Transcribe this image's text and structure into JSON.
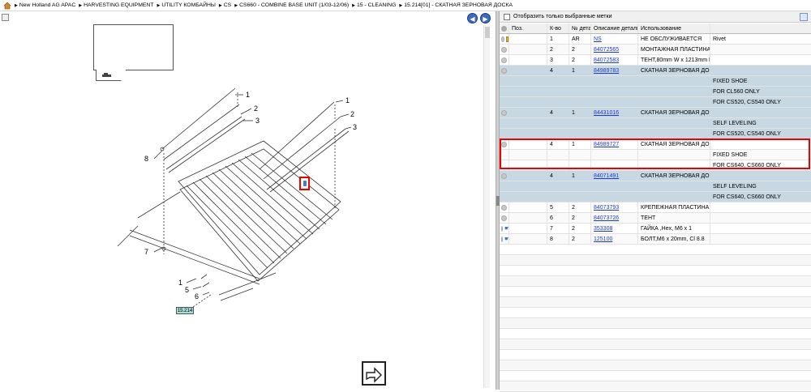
{
  "breadcrumb": [
    "New Holland AG APAC",
    "HARVESTING EQUIPMENT",
    "UTILITY КОМБАЙНЫ",
    "CS",
    "CS660 - COMBINE BASE UNIT (1/03-12/06)",
    "15 - CLEANING",
    "15.214[01] - СКАТНАЯ ЗЕРНОВАЯ ДОСКА"
  ],
  "filter_label": "Отобразить только выбранные метки",
  "columns": [
    "",
    "Поз.",
    "К-во",
    "№ детали",
    "Описание детали",
    "Использование"
  ],
  "rows": [
    {
      "kind": "part",
      "icons": [
        "circle",
        "box"
      ],
      "pos": "1",
      "qty": "AR",
      "part": "NS",
      "desc": "НЕ ОБСЛУЖИВАЕТСЯ",
      "use": "Rivet"
    },
    {
      "kind": "part",
      "icons": [
        "circle"
      ],
      "pos": "2",
      "qty": "2",
      "part": "84072565",
      "desc": "МОНТАЖНАЯ ПЛАСТИНА",
      "use": ""
    },
    {
      "kind": "part",
      "icons": [
        "circle"
      ],
      "pos": "3",
      "qty": "2",
      "part": "84072583",
      "desc": "ТЕНТ,80mm W x 1213mm L",
      "use": ""
    },
    {
      "kind": "blue",
      "icons": [
        "circle"
      ],
      "pos": "4",
      "qty": "1",
      "part": "84989783",
      "desc": "СКАТНАЯ ЗЕРНОВАЯ ДОС",
      "use": ""
    },
    {
      "kind": "blue",
      "icons": [],
      "pos": "",
      "qty": "",
      "part": "",
      "desc": "",
      "use": "FIXED SHOE"
    },
    {
      "kind": "blue",
      "icons": [],
      "pos": "",
      "qty": "",
      "part": "",
      "desc": "",
      "use": "FOR CL560 ONLY"
    },
    {
      "kind": "blue",
      "icons": [],
      "pos": "",
      "qty": "",
      "part": "",
      "desc": "",
      "use": "FOR CS520, CS540 ONLY"
    },
    {
      "kind": "blue",
      "icons": [
        "circle"
      ],
      "pos": "4",
      "qty": "1",
      "part": "84431016",
      "desc": "СКАТНАЯ ЗЕРНОВАЯ ДОС",
      "use": ""
    },
    {
      "kind": "blue",
      "icons": [],
      "pos": "",
      "qty": "",
      "part": "",
      "desc": "",
      "use": "SELF LEVELING"
    },
    {
      "kind": "blue",
      "icons": [],
      "pos": "",
      "qty": "",
      "part": "",
      "desc": "",
      "use": "FOR CS520, CS540 ONLY"
    },
    {
      "kind": "part",
      "icons": [
        "circle"
      ],
      "pos": "4",
      "qty": "1",
      "part": "84989727",
      "desc": "СКАТНАЯ ЗЕРНОВАЯ ДОС",
      "use": ""
    },
    {
      "kind": "part",
      "icons": [],
      "pos": "",
      "qty": "",
      "part": "",
      "desc": "",
      "use": "FIXED SHOE"
    },
    {
      "kind": "part",
      "icons": [],
      "pos": "",
      "qty": "",
      "part": "",
      "desc": "",
      "use": "FOR CS640, CS660 ONLY"
    },
    {
      "kind": "blue",
      "icons": [
        "circle"
      ],
      "pos": "4",
      "qty": "1",
      "part": "84071491",
      "desc": "СКАТНАЯ ЗЕРНОВАЯ ДОС",
      "use": ""
    },
    {
      "kind": "blue",
      "icons": [],
      "pos": "",
      "qty": "",
      "part": "",
      "desc": "",
      "use": "SELF LEVELING"
    },
    {
      "kind": "blue",
      "icons": [],
      "pos": "",
      "qty": "",
      "part": "",
      "desc": "",
      "use": "FOR CS640, CS660 ONLY"
    },
    {
      "kind": "part",
      "icons": [
        "circle"
      ],
      "pos": "5",
      "qty": "2",
      "part": "84073793",
      "desc": "КРЕПЕЖНАЯ ПЛАСТИНА",
      "use": ""
    },
    {
      "kind": "part",
      "icons": [
        "circle"
      ],
      "pos": "6",
      "qty": "2",
      "part": "84073726",
      "desc": "ТЕНТ",
      "use": ""
    },
    {
      "kind": "part",
      "icons": [
        "circle",
        "hand",
        "box"
      ],
      "pos": "7",
      "qty": "2",
      "part": "353308",
      "desc": "ГАЙКА ,Hex, M6 x 1",
      "use": ""
    },
    {
      "kind": "part",
      "icons": [
        "circle",
        "hand",
        "box"
      ],
      "pos": "8",
      "qty": "2",
      "part": "125100",
      "desc": "БОЛТ,M6 x 20mm, Cl 8.8",
      "use": ""
    }
  ],
  "diagram": {
    "callouts": [
      "1",
      "2",
      "3",
      "1",
      "2",
      "3",
      "8",
      "7",
      "1",
      "5",
      "6"
    ],
    "tag": "15.214"
  }
}
